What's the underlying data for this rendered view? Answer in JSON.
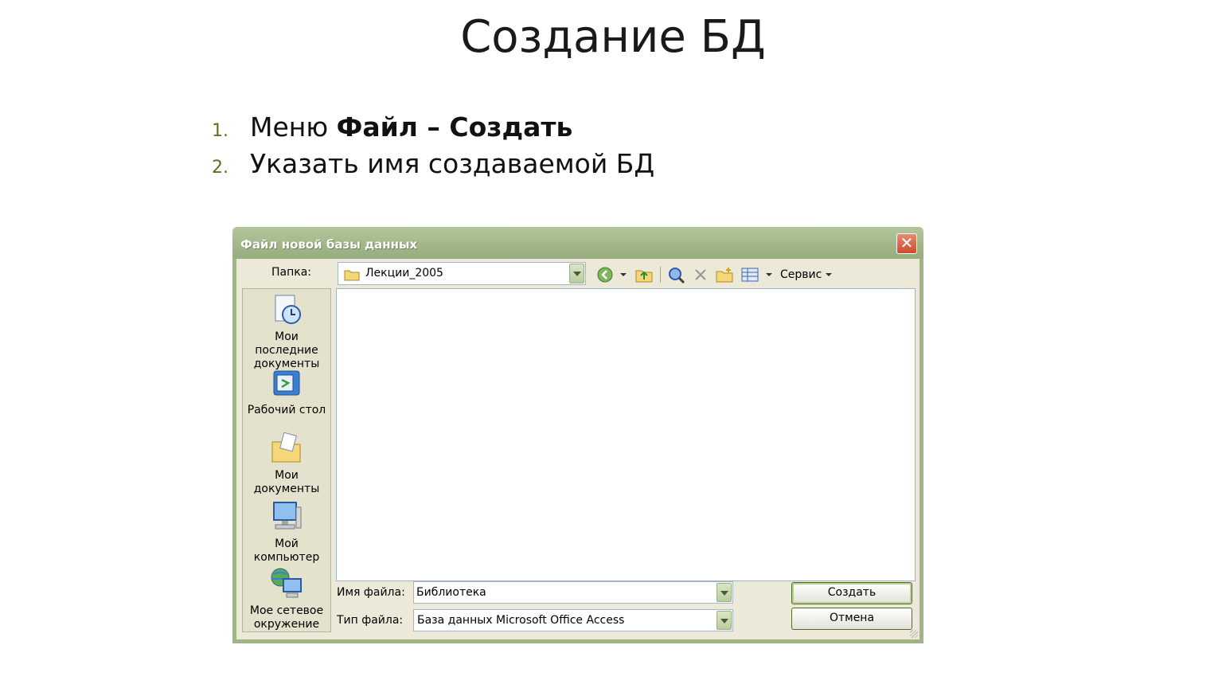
{
  "slide": {
    "title": "Создание БД",
    "steps": [
      {
        "num": "1.",
        "prefix": "Меню ",
        "bold": "Файл – Создать"
      },
      {
        "num": "2.",
        "prefix": "Указать имя создаваемой БД",
        "bold": ""
      }
    ]
  },
  "dialog": {
    "title": "Файл новой базы данных",
    "folder_label": "Папка:",
    "folder_value": "Лекции_2005",
    "tools_label": "Сервис",
    "places": [
      {
        "line1": "Мои последние",
        "line2": "документы",
        "icon": "recent-documents-icon"
      },
      {
        "line1": "Рабочий стол",
        "line2": "",
        "icon": "desktop-icon"
      },
      {
        "line1": "Мои",
        "line2": "документы",
        "icon": "my-documents-icon"
      },
      {
        "line1": "Мой",
        "line2": "компьютер",
        "icon": "my-computer-icon"
      },
      {
        "line1": "Мое сетевое",
        "line2": "окружение",
        "icon": "network-places-icon"
      }
    ],
    "filename_label": "Имя файла:",
    "filename_value": "Библиотека",
    "filetype_label": "Тип файла:",
    "filetype_value": "База данных Microsoft Office Access",
    "create_button": "Создать",
    "cancel_button": "Отмена",
    "close_glyph": "✕"
  }
}
